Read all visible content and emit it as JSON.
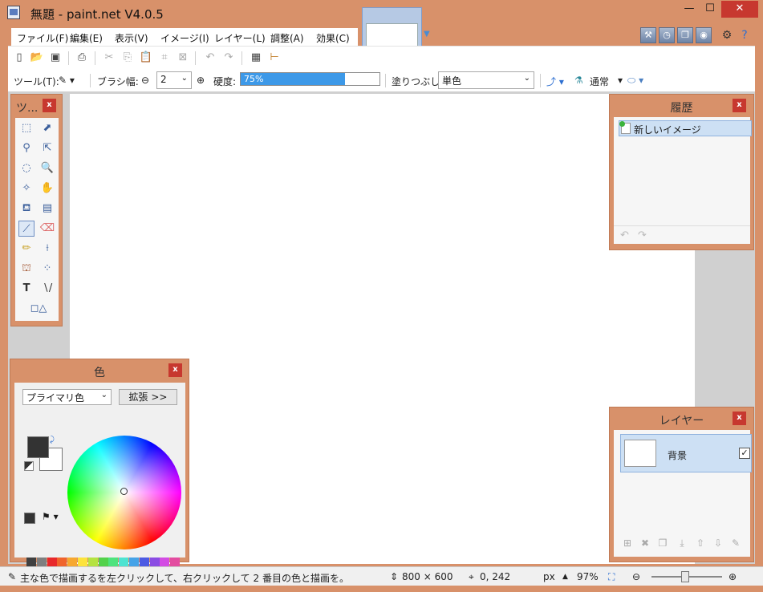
{
  "window": {
    "title": "無題 - paint.net V4.0.5",
    "minimize": "—",
    "maximize": "☐",
    "close": "✕"
  },
  "menu": {
    "items": [
      "ファイル(F)",
      "編集(E)",
      "表示(V)",
      "イメージ(I)",
      "レイヤー(L)",
      "調整(A)",
      "効果(C)"
    ]
  },
  "toolbar2": {
    "tool_label": "ツール(T):",
    "brush_width_label": "ブラシ幅:",
    "brush_width_value": "2",
    "hardness_label": "硬度:",
    "hardness_value": "75%",
    "hardness_fraction": 0.75,
    "fill_label": "塗りつぶし:",
    "fill_value": "単色",
    "blend_mode": "通常"
  },
  "tools_panel": {
    "title": "ツ...",
    "close": "x"
  },
  "history_panel": {
    "title": "履歴",
    "close": "x",
    "items": [
      "新しいイメージ"
    ]
  },
  "colors_panel": {
    "title": "色",
    "close": "x",
    "mode_select": "プライマリ色",
    "more_button": "拡張 >>",
    "primary_color": "#333333",
    "secondary_color": "#ffffff"
  },
  "layers_panel": {
    "title": "レイヤー",
    "close": "x",
    "layers": [
      {
        "name": "背景",
        "visible": true
      }
    ]
  },
  "statusbar": {
    "hint": "主な色で描画するを左クリックして、右クリックして 2 番目の色と描画を。",
    "image_size": "800 × 600",
    "cursor_pos": "0, 242",
    "unit": "px",
    "zoom": "97%"
  },
  "palette": {
    "top": [
      "#404040",
      "#7f7f7f",
      "#e8282b",
      "#f0642c",
      "#f7a830",
      "#fde33c",
      "#b5e341",
      "#53d24b",
      "#4ee37e",
      "#4de3d1",
      "#45a3e8",
      "#4c5ae3",
      "#8a4ce3",
      "#d34ce3",
      "#e34ca0"
    ],
    "bottom": [
      "#1a1a1a",
      "#bfbfbf",
      "#8c1c1e",
      "#8f3f1d",
      "#91651e",
      "#968826",
      "#6d8a28",
      "#337e2e",
      "#2f884d",
      "#2e877c",
      "#2a628b",
      "#2d3687",
      "#522d87",
      "#7f2d87",
      "#872e60"
    ]
  }
}
